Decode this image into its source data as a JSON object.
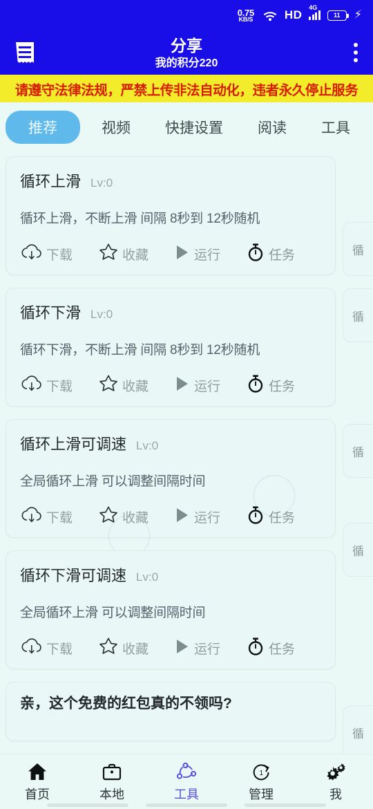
{
  "statusbar": {
    "net_speed_value": "0.75",
    "net_speed_unit": "KB/S",
    "wifi_icon": "wifi-icon",
    "hd_label": "HD",
    "network_type": "4G",
    "signal_icon": "signal-bars-icon",
    "battery_level": "11",
    "charging_icon": "charging-bolt-icon"
  },
  "appbar": {
    "menu_icon": "receipt-list-icon",
    "title": "分享",
    "subtitle": "我的积分220",
    "overflow_icon": "more-vertical-icon"
  },
  "notice": {
    "text": "请遵守法律法规，严禁上传非法自动化，违者永久停止服务",
    "bg_color": "#f2ec2a",
    "text_color": "#d61d00"
  },
  "tabs": {
    "selected_index": 0,
    "items": [
      {
        "label": "推荐"
      },
      {
        "label": "视频"
      },
      {
        "label": "快捷设置"
      },
      {
        "label": "阅读"
      },
      {
        "label": "工具"
      }
    ],
    "selected_bg": "#5fb9eb"
  },
  "actions": {
    "download": {
      "label": "下载",
      "icon": "cloud-download-icon"
    },
    "favorite": {
      "label": "收藏",
      "icon": "star-outline-icon"
    },
    "run": {
      "label": "运行",
      "icon": "play-triangle-icon"
    },
    "task": {
      "label": "任务",
      "icon": "stopwatch-icon"
    }
  },
  "cards": [
    {
      "title": "循环上滑",
      "level": "Lv:0",
      "desc": "循环上滑，不断上滑 间隔 8秒到 12秒随机",
      "peek_text": "循"
    },
    {
      "title": "循环下滑",
      "level": "Lv:0",
      "desc": "循环下滑，不断上滑 间隔 8秒到 12秒随机",
      "peek_text": "循"
    },
    {
      "title": "循环上滑可调速",
      "level": "Lv:0",
      "desc": "全局循环上滑 可以调整间隔时间",
      "peek_text": "循"
    },
    {
      "title": "循环下滑可调速",
      "level": "Lv:0",
      "desc": "全局循环上滑 可以调整间隔时间",
      "peek_text": "循"
    }
  ],
  "partial_card": {
    "title": "亲，这个免费的红包真的不领吗?",
    "peek_text": "循"
  },
  "bottomnav": {
    "selected_index": 2,
    "selected_color": "#5b4fe0",
    "items": [
      {
        "label": "首页",
        "icon": "home-icon"
      },
      {
        "label": "本地",
        "icon": "briefcase-icon"
      },
      {
        "label": "工具",
        "icon": "share-nodes-icon"
      },
      {
        "label": "管理",
        "icon": "refresh-one-icon"
      },
      {
        "label": "我",
        "icon": "gears-icon"
      }
    ]
  }
}
